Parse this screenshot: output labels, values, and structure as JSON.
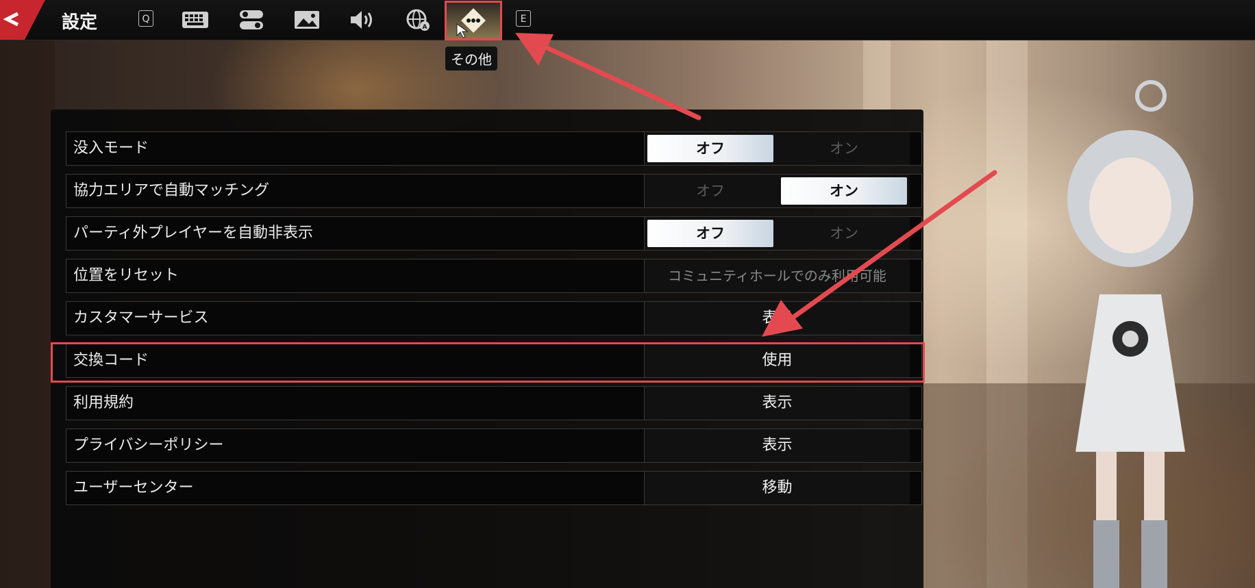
{
  "header": {
    "title": "設定",
    "left_key": "Q",
    "right_key": "E",
    "tabs": [
      {
        "icon": "keyboard-icon"
      },
      {
        "icon": "toggle-switch-icon"
      },
      {
        "icon": "image-icon"
      },
      {
        "icon": "speaker-icon"
      },
      {
        "icon": "globe-icon"
      },
      {
        "icon": "more-options-icon"
      }
    ],
    "active_tab_tooltip": "その他"
  },
  "settings": {
    "immersive_mode": {
      "label": "没入モード",
      "off": "オフ",
      "on": "オン",
      "selected": "off"
    },
    "auto_matching": {
      "label": "協力エリアで自動マッチング",
      "off": "オフ",
      "on": "オン",
      "selected": "on"
    },
    "hide_players": {
      "label": "パーティ外プレイヤーを自動非表示",
      "off": "オフ",
      "on": "オン",
      "selected": "off"
    },
    "reset_position": {
      "label": "位置をリセット",
      "value": "コミュニティホールでのみ利用可能"
    },
    "customer_service": {
      "label": "カスタマーサービス",
      "value": "表示"
    },
    "redeem_code": {
      "label": "交換コード",
      "value": "使用"
    },
    "terms": {
      "label": "利用規約",
      "value": "表示"
    },
    "privacy": {
      "label": "プライバシーポリシー",
      "value": "表示"
    },
    "user_center": {
      "label": "ユーザーセンター",
      "value": "移動"
    }
  },
  "colors": {
    "highlight": "#e34a50",
    "selected_toggle": "#ffffff",
    "panel": "#0a0a0a"
  }
}
